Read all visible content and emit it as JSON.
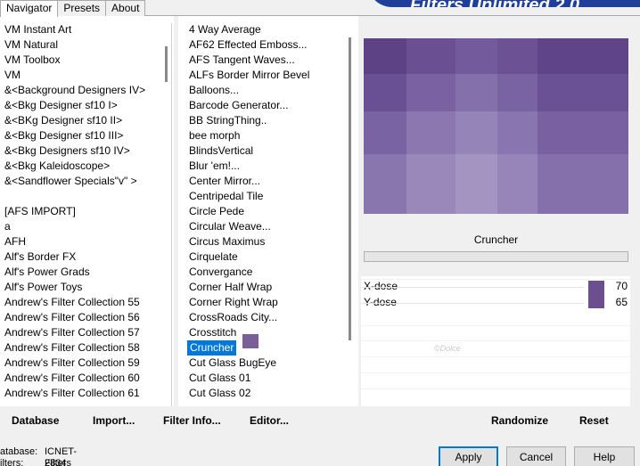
{
  "tabs": [
    {
      "label": "Navigator",
      "active": true
    },
    {
      "label": "Presets",
      "active": false
    },
    {
      "label": "About",
      "active": false
    }
  ],
  "banner_text": "Filters Unlimited 2.0",
  "categories": [
    "VM Instant Art",
    "VM Natural",
    "VM Toolbox",
    "VM",
    "&<Background Designers IV>",
    "&<Bkg Designer sf10 I>",
    "&<BKg Designer sf10 II>",
    "&<Bkg Designer sf10 III>",
    "&<Bkg Designers sf10 IV>",
    "&<Bkg Kaleidoscope>",
    "&<Sandflower Specials\"v\" >",
    "",
    "[AFS IMPORT]",
    "a",
    "AFH",
    "Alf's Border FX",
    "Alf's Power Grads",
    "Alf's Power Toys",
    "Andrew's Filter Collection 55",
    "Andrew's Filter Collection 56",
    "Andrew's Filter Collection 57",
    "Andrew's Filter Collection 58",
    "Andrew's Filter Collection 59",
    "Andrew's Filter Collection 60",
    "Andrew's Filter Collection 61"
  ],
  "filters": [
    "4 Way Average",
    "AF62 Effected Emboss...",
    "AFS Tangent Waves...",
    "ALFs Border Mirror Bevel",
    "Balloons...",
    "Barcode Generator...",
    "BB StringThing..",
    "bee morph",
    "BlindsVertical",
    "Blur 'em!...",
    "Center Mirror...",
    "Centripedal Tile",
    "Circle Pede",
    "Circular Weave...",
    "Circus Maximus",
    "Cirquelate",
    "Convergance",
    "Corner Half Wrap",
    "Corner Right Wrap",
    "CrossRoads City...",
    "Crosstitch",
    "Cruncher",
    "Cut Glass  BugEye",
    "Cut Glass 01",
    "Cut Glass 02"
  ],
  "selected_filter": "Cruncher",
  "filter_name": "Cruncher",
  "params": [
    {
      "label": "X-dose",
      "value": "70"
    },
    {
      "label": "Y-dose",
      "value": "65"
    }
  ],
  "watermark": "©Dolce",
  "links": {
    "database": "Database",
    "import": "Import...",
    "filter_info": "Filter Info...",
    "editor": "Editor...",
    "randomize": "Randomize",
    "reset": "Reset"
  },
  "status": {
    "database_label": "atabase:",
    "database_value": "ICNET-Filters",
    "filters_label": "ilters:",
    "filters_value": "2834"
  },
  "buttons": {
    "apply": "Apply",
    "cancel": "Cancel",
    "help": "Help"
  },
  "colors": {
    "accent": "#0078d7",
    "swatch": "#6b4f8f",
    "preview_base": "#6f5696",
    "banner": "#1f3f9a"
  }
}
